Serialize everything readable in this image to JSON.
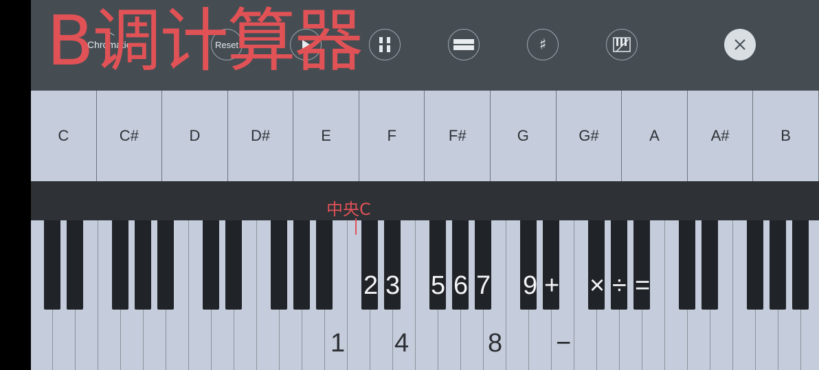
{
  "overlay": {
    "title": "B调计算器"
  },
  "toolbar": {
    "scale_label": "Chromatic",
    "reset_label": "Reset",
    "sharp_symbol": "♯"
  },
  "notes": [
    "C",
    "C#",
    "D",
    "D#",
    "E",
    "F",
    "F#",
    "G",
    "G#",
    "A",
    "A#",
    "B"
  ],
  "keyboard": {
    "middle_c_label": "中央C",
    "numbers": [
      "1",
      "2",
      "3",
      "4",
      "5",
      "6",
      "7",
      "8",
      "9",
      "+",
      "−",
      "×",
      "÷",
      "="
    ]
  },
  "colors": {
    "accent": "#e05256",
    "toolbar": "#454d53",
    "key_light": "#c5cddc",
    "key_dark": "#202327"
  }
}
